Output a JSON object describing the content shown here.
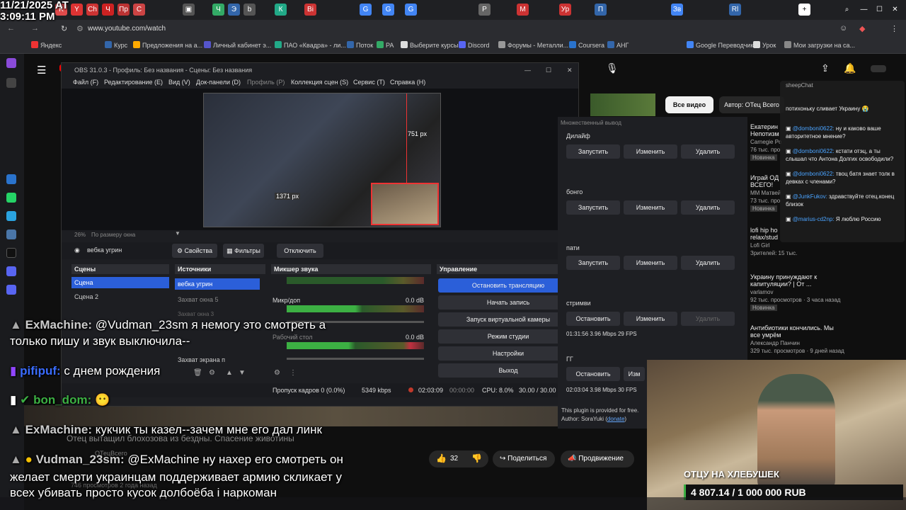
{
  "clock": {
    "date": "11/21/2025 AT",
    "time": "3:09:11 PM"
  },
  "browser": {
    "url": "www.youtube.com/watch"
  },
  "bookmarks": [
    "Яндекс",
    "Курс",
    "Предложения на а...",
    "Личный кабинет э...",
    "ПАО «Квадра» - ли...",
    "Поток",
    "PA",
    "Выберите курсы",
    "Discord",
    "Форумы - Металли...",
    "Coursera",
    "АНГ",
    "Google Переводчик",
    "Урок",
    "Мои загрузки на са..."
  ],
  "obs": {
    "title": "OBS 31.0.3 - Профиль: Без названия - Сцены: Без названия",
    "menu": [
      "Файл (F)",
      "Редактирование (E)",
      "Вид (V)",
      "Док-панели (D)",
      "Профиль (P)",
      "Коллекция сцен (S)",
      "Сервис (T)",
      "Справка (H)"
    ],
    "preview_res": "1371 px",
    "preview_res2": "751 px",
    "zoom": "26%",
    "zoom_label": "По размеру окна",
    "source_name": "вебка угрин",
    "props": "Свойства",
    "filters": "Фильтры",
    "disable": "Отключить",
    "scenes_hdr": "Сцены",
    "scenes": [
      "Сцена",
      "Сцена 2"
    ],
    "sources_hdr": "Источники",
    "sources": [
      "вебка угрин",
      "Захват окна 5",
      "Захват окна 3",
      "Захват экрана п"
    ],
    "mixer_hdr": "Микшер звука",
    "mic": "Микр/доп",
    "mic_db": "0.0 dB",
    "desktop": "Рабочий стол",
    "desktop_db": "0.0 dB",
    "controls_hdr": "Управление",
    "controls": [
      "Остановить трансляцию",
      "Начать запись",
      "Запуск виртуальной камеры",
      "Режим студии",
      "Настройки",
      "Выход"
    ],
    "status": {
      "frames": "Пропуск кадров 0 (0.0%)",
      "kbps": "5349 kbps",
      "live": "02:03:09",
      "rec": "00:00:00",
      "cpu": "CPU: 8.0%",
      "fps": "30.00 / 30.00 F"
    }
  },
  "multi": {
    "title": "Множественный вывод",
    "targets": [
      {
        "name": "Дилайф",
        "start": "Запустить",
        "edit": "Изменить",
        "del": "Удалить"
      },
      {
        "name": "бонго",
        "start": "Запустить",
        "edit": "Изменить",
        "del": "Удалить"
      },
      {
        "name": "пати",
        "start": "Запустить",
        "edit": "Изменить",
        "del": "Удалить"
      },
      {
        "name": "стримви",
        "start": "Остановить",
        "edit": "Изменить",
        "del": "Удалить",
        "stats": "01:31:56  3.96 Mbps  29 FPS"
      },
      {
        "name": "ГГ",
        "start": "Остановить",
        "edit": "Изм",
        "stats": "02:03:04  3.98 Mbps  30 FPS"
      }
    ],
    "footer": "This plugin is provided for free.",
    "author": "Author: SoraYuki (",
    "donate": "donate",
    "author_end": ")"
  },
  "yt": {
    "filter_all": "Все видео",
    "filter_author": "Автор: ОТец Всего",
    "videos": [
      {
        "title": "Екатерин",
        "sub": "Непотизм",
        "meta": "Carnegie Po",
        "views": "76 тыс. про",
        "badge": "Новинка"
      },
      {
        "title": "Играй ОД",
        "sub": "ВСЕГО!",
        "meta": "ММ Матвей",
        "views": "73 тыс. про",
        "badge": "Новинка"
      },
      {
        "title": "lofi hip ho",
        "sub": "relax/stud",
        "meta": "Lofi Girl",
        "views": "Зрителей: 15 тыс."
      },
      {
        "title": "Украину принуждают к",
        "sub": "капитуляции? | От ...",
        "meta": "varlamov",
        "views": "92 тыс. просмотров · 3 часа назад",
        "badge": "Новинка"
      },
      {
        "title": "Антибиотики кончились. Мы",
        "sub": "все умрём",
        "meta": "Александр Панчин",
        "views": "329 тыс. просмотров · 9 дней назад"
      }
    ],
    "video_desc": "Отец вытащил блохозова из бездны. Спасение животины",
    "channel": "ОТецВсего",
    "views_line": "746 просмотров  2 года назад",
    "likes": "32",
    "share": "Поделиться",
    "promote": "Продвижение"
  },
  "chat_widget": {
    "title": "sheepChat",
    "lines": [
      {
        "user": "",
        "text": "потихоньку сливает Украину 😭"
      },
      {
        "user": "@domboni0622:",
        "text": "ну и каково ваше авторитетное мнение?"
      },
      {
        "user": "@domboni0622:",
        "text": "кстати отэц, а ты слышал что Антона Долгих освободили?"
      },
      {
        "user": "@domboni0622:",
        "text": "твоц батя знает толк в девках с членами?"
      },
      {
        "user": "@JunkFukov:",
        "text": "здравствуйте отец.конец близок"
      },
      {
        "user": "@marius-cd2np:",
        "text": "Я люблю Россию"
      }
    ]
  },
  "overlay_chat": [
    {
      "user": "ExMachine:",
      "text": "@Vudman_23sm я немогу это смотреть а",
      "text2": "только пишу и звук выключила--"
    },
    {
      "user": "pifipuf:",
      "text": "с днем рождения"
    },
    {
      "user": "bon_dom:",
      "text": "😶"
    },
    {
      "user": "ExMachine:",
      "text": "кукчик ты казел--зачем мне его дал линк"
    },
    {
      "user": "Vudman_23sm:",
      "text": "@ExMachine ну нахер его смотреть он",
      "text2": "желает смерти украинцам поддерживает армию скликает у",
      "text3": "всех убивать просто кусок долбоёба і наркоман"
    }
  ],
  "cam_overlay": {
    "label": "ОТЦУ НА ХЛЕБУШЕК",
    "amount": "4 807.14 / 1 000 000 RUB"
  },
  "colors": {
    "accent": "#2b5fd9",
    "stop": "#c0392b",
    "green": "#3cb043"
  }
}
